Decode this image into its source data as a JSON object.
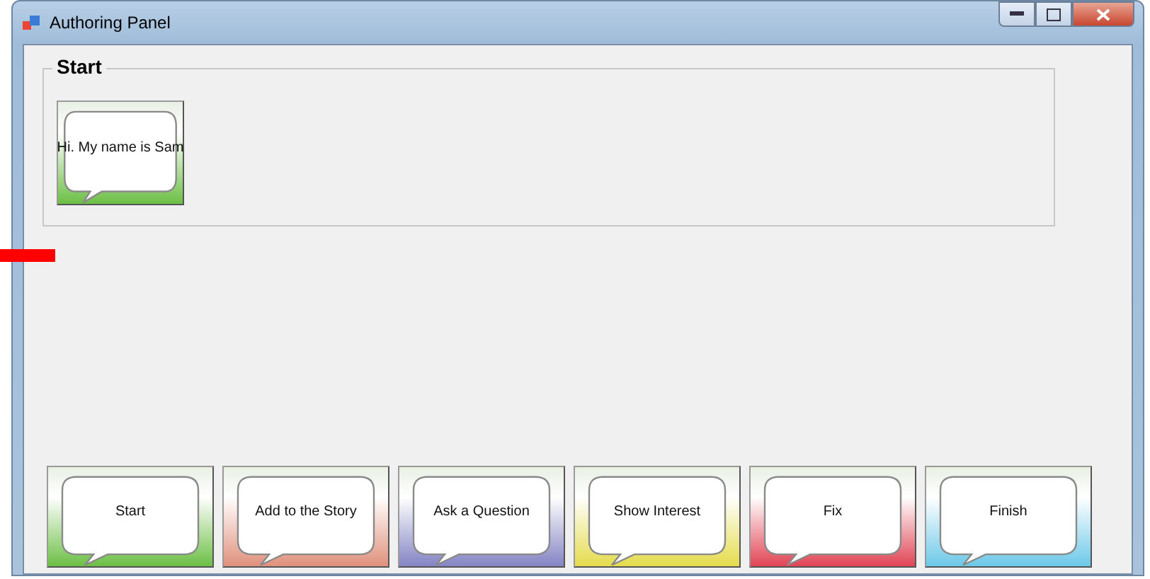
{
  "window": {
    "title": "Authoring Panel"
  },
  "group": {
    "title": "Start",
    "cards": [
      {
        "label": "Hi. My name is Sam",
        "color": "#6cbf45"
      }
    ]
  },
  "palette": [
    {
      "label": "Start",
      "color": "#6cbf45"
    },
    {
      "label": "Add to the Story",
      "color": "#e0907c"
    },
    {
      "label": "Ask a Question",
      "color": "#8484c4"
    },
    {
      "label": "Show Interest",
      "color": "#e4dc4c"
    },
    {
      "label": "Fix",
      "color": "#e04454"
    },
    {
      "label": "Finish",
      "color": "#6cc8e8"
    }
  ]
}
